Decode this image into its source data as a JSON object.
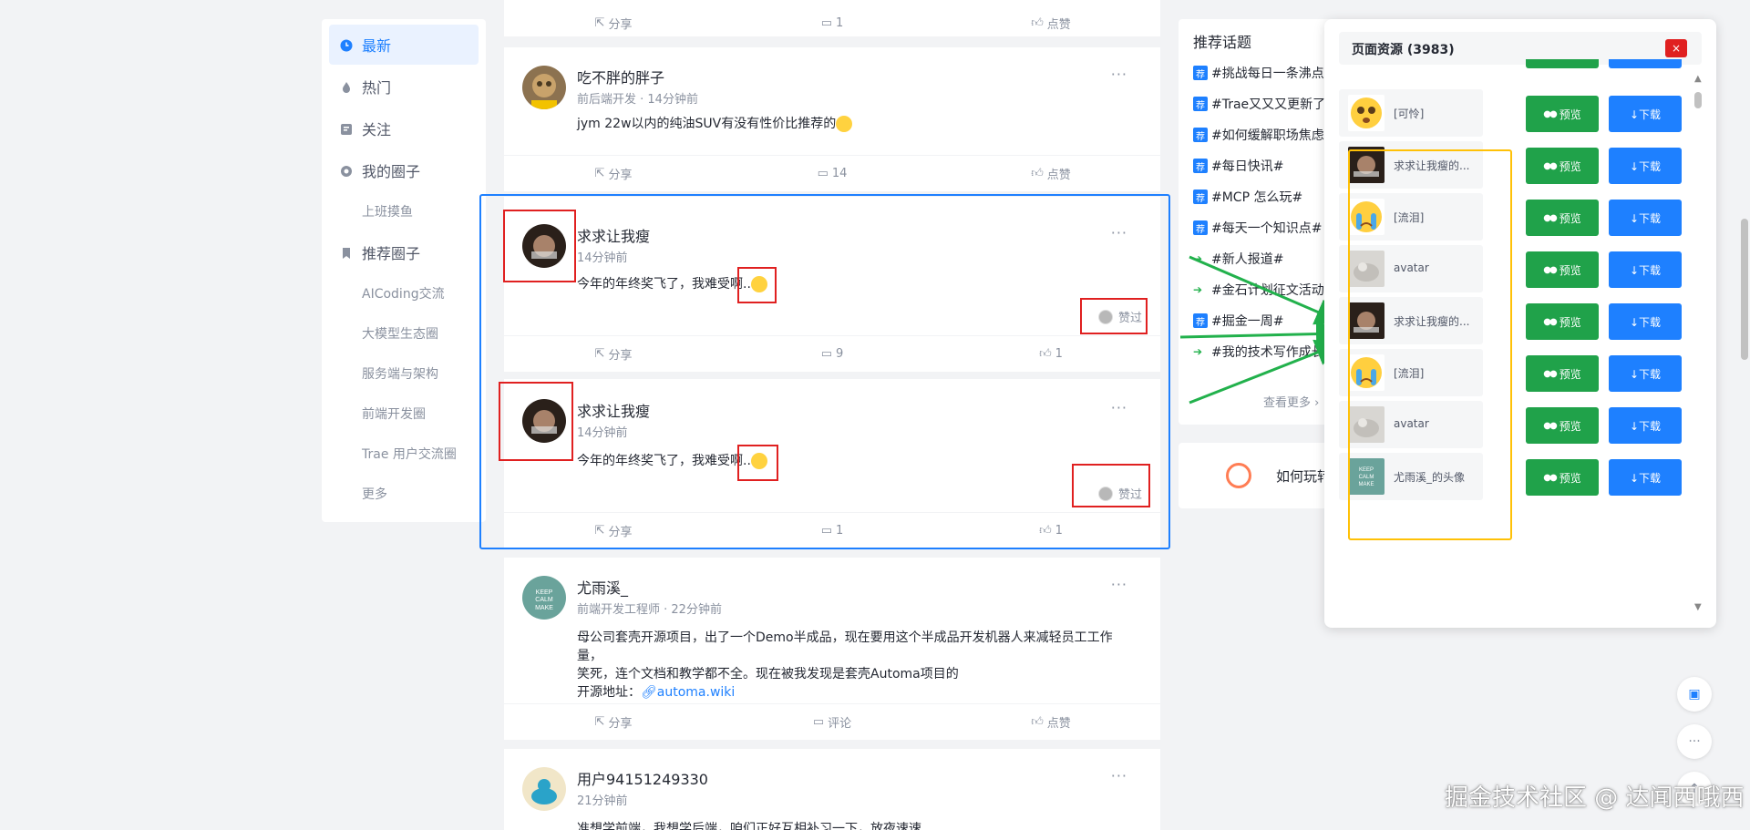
{
  "nav": {
    "items": [
      {
        "label": "最新",
        "icon": "clock-icon",
        "active": true
      },
      {
        "label": "热门",
        "icon": "fire-icon"
      },
      {
        "label": "关注",
        "icon": "follow-icon"
      },
      {
        "label": "我的圈子",
        "icon": "circle-icon"
      }
    ],
    "my_circles": [
      "上班摸鱼"
    ],
    "recommended_label": "推荐圈子",
    "recommended": [
      "AICoding交流",
      "大模型生态圈",
      "服务端与架构",
      "前端开发圈",
      "Trae 用户交流圈",
      "更多"
    ]
  },
  "feed": {
    "top_actions": {
      "share": "分享",
      "comment": "1",
      "like": "点赞"
    },
    "posts": [
      {
        "name": "吃不胖的胖子",
        "meta": "前后端开发 · 14分钟前",
        "content": "jym 22w以内的纯油SUV有没有性价比推荐的",
        "share": "分享",
        "comment": "14",
        "like": "点赞"
      },
      {
        "name": "求求让我瘦",
        "meta": "14分钟前",
        "content": "今年的年终奖飞了，我难受啊..",
        "liked": "赞过",
        "share": "分享",
        "comment": "9",
        "like": "1"
      },
      {
        "name": "求求让我瘦",
        "meta": "14分钟前",
        "content": "今年的年终奖飞了，我难受啊..",
        "liked": "赞过",
        "share": "分享",
        "comment": "1",
        "like": "1"
      },
      {
        "name": "尤雨溪_",
        "meta": "前端开发工程师 · 22分钟前",
        "content_lines": [
          "母公司套壳开源项目，出了一个Demo半成品，现在要用这个半成品开发机器人来减轻员工工作量，",
          "笑死，连个文档和教学都不全。现在被我发现是套壳Automa项目的"
        ],
        "source_label": "开源地址：",
        "source_link": "automa.wiki",
        "share": "分享",
        "comment": "评论",
        "like": "点赞"
      },
      {
        "name": "用户94151249330",
        "meta": "21分钟前",
        "content": "准想学前端，我想学后端，咱们正好互相补习一下，放夜速速"
      }
    ]
  },
  "topics": {
    "title": "推荐话题",
    "items": [
      "#挑战每日一条沸点#",
      "#Trae又又又更新了#",
      "#如何缓解职场焦虑#",
      "#每日快讯#",
      "#MCP 怎么玩#",
      "#每天一个知识点#",
      "#新人报道#",
      "#金石计划征文活动#",
      "#掘金一周#",
      "#我的技术写作成长之路#"
    ],
    "more": "查看更多",
    "howplay": "如何玩转"
  },
  "panel": {
    "title": "页面资源 (3983)",
    "close": "×",
    "preview_label": "预览",
    "download_label": "↓下载",
    "rows": [
      {
        "name": "[可怜]",
        "kind": "emoji-pity"
      },
      {
        "name": "求求让我瘦的...",
        "kind": "photo"
      },
      {
        "name": "[流泪]",
        "kind": "emoji-cry"
      },
      {
        "name": "avatar",
        "kind": "cat"
      },
      {
        "name": "求求让我瘦的...",
        "kind": "photo"
      },
      {
        "name": "[流泪]",
        "kind": "emoji-cry"
      },
      {
        "name": "avatar",
        "kind": "cat"
      },
      {
        "name": "尤雨溪_的头像",
        "kind": "keepcalm"
      }
    ]
  },
  "watermark": "掘金技术社区 @ 达闻西哦西",
  "colors": {
    "accent": "#1e80ff",
    "green": "#20a24a",
    "red_box": "#e02020",
    "blue_box": "#1e80ff",
    "yellow_box": "#ffc107",
    "arrow": "#22b14c"
  }
}
